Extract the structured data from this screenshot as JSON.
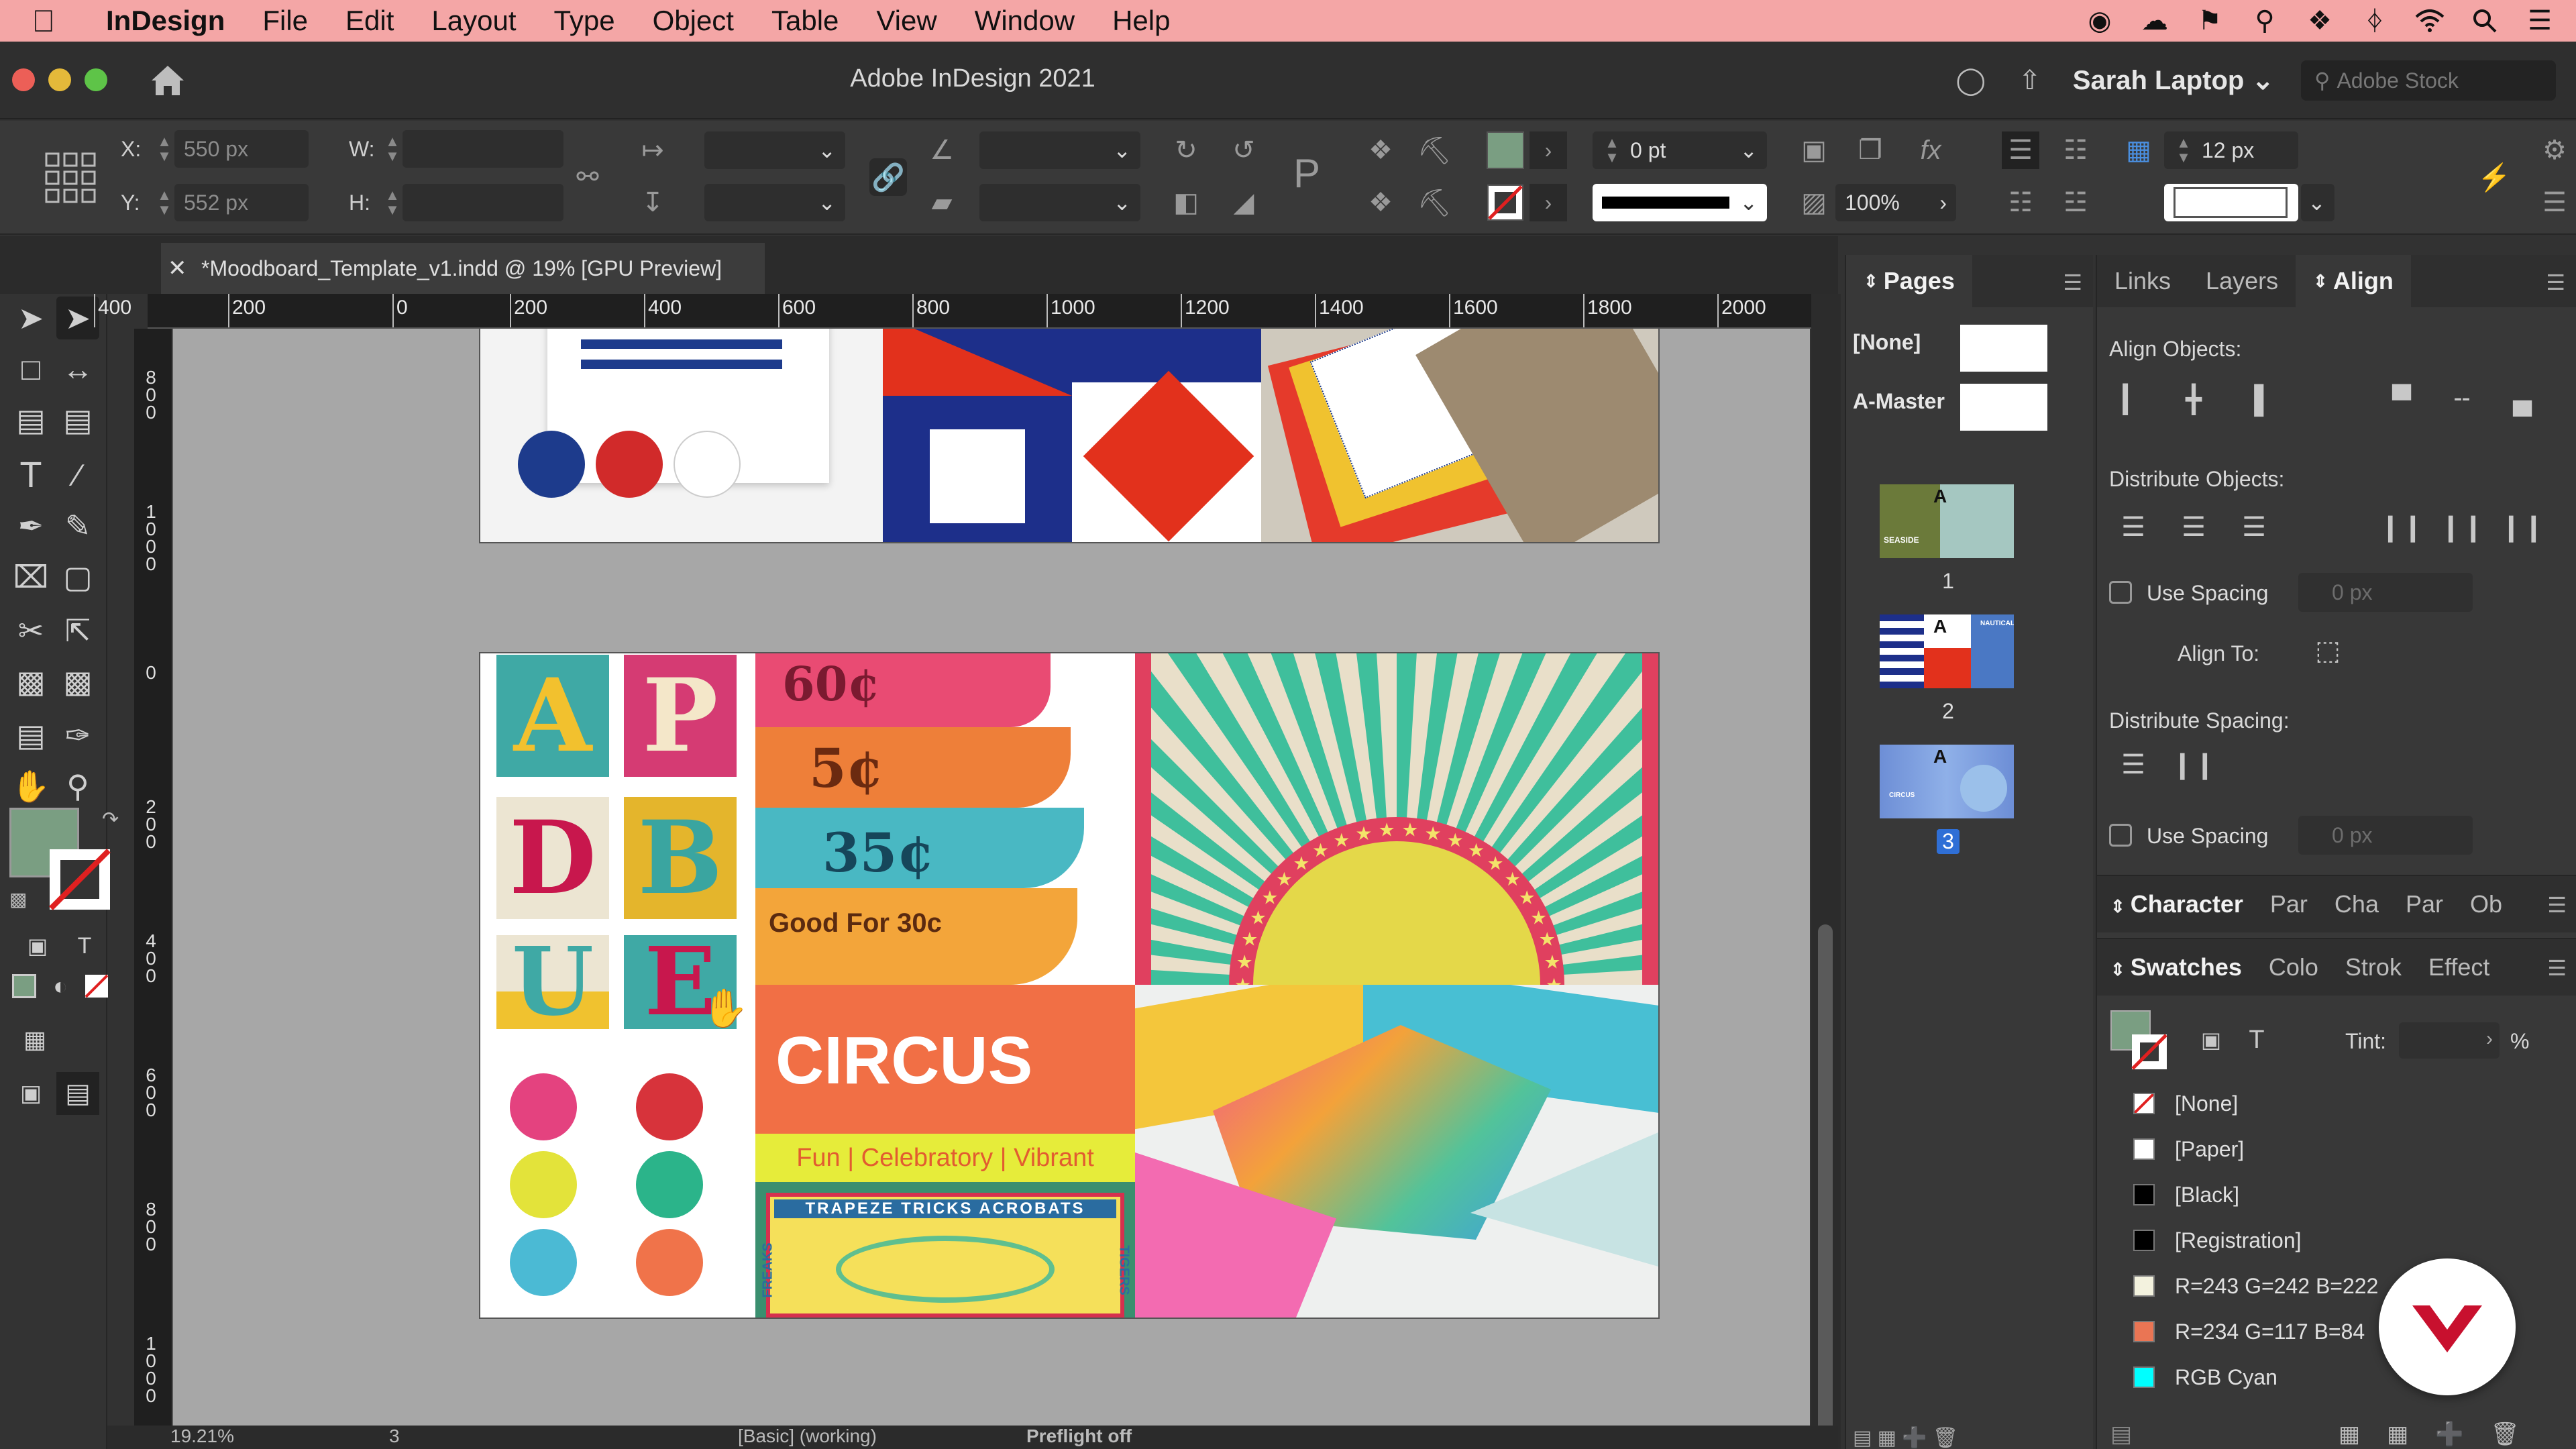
{
  "menubar": {
    "apple_icon": "apple-icon",
    "items": [
      "InDesign",
      "File",
      "Edit",
      "Layout",
      "Type",
      "Object",
      "Table",
      "View",
      "Window",
      "Help"
    ]
  },
  "titlebar": {
    "title": "Adobe InDesign 2021",
    "user": "Sarah Laptop",
    "stock_placeholder": "Adobe Stock"
  },
  "controlbar": {
    "x_label": "X:",
    "x_value": "550 px",
    "y_label": "Y:",
    "y_value": "552 px",
    "w_label": "W:",
    "w_value": "",
    "h_label": "H:",
    "h_value": "",
    "stroke_weight": "0 pt",
    "opacity": "100%",
    "spacing": "12 px",
    "fill_color": "#7a9e82"
  },
  "document_tab": {
    "title": "*Moodboard_Template_v1.indd @ 19% [GPU Preview]"
  },
  "ruler": {
    "h_ticks": [
      "400",
      "200",
      "0",
      "200",
      "400",
      "600",
      "800",
      "1000",
      "1200",
      "1400",
      "1600",
      "1800",
      "2000"
    ],
    "v_ticks": [
      "800",
      "1000",
      "0",
      "200",
      "400",
      "600",
      "800",
      "1000"
    ]
  },
  "canvas": {
    "circus_title": "CIRCUS",
    "circus_tagline": "Fun | Celebratory | Vibrant",
    "ticket_numbers": [
      "60¢",
      "5¢",
      "35¢"
    ],
    "ticket_text": "Good For 30c",
    "poster_text": "TRAPEZE TRICKS ACROBATS",
    "poster_side_left": "FREAKS",
    "poster_side_right": "TIGERS",
    "letters": [
      "A",
      "P",
      "D",
      "B",
      "U",
      "E"
    ],
    "palette": [
      "#e4427f",
      "#d7333b",
      "#e3e33a",
      "#2bb48a",
      "#4bbad4",
      "#f0734a"
    ]
  },
  "status": {
    "zoom": "19.21%",
    "page": "3",
    "profile": "[Basic] (working)",
    "preflight": "Preflight off"
  },
  "pages_panel": {
    "title": "Pages",
    "masters": [
      "[None]",
      "A-Master"
    ],
    "pages": [
      "1",
      "2",
      "3"
    ],
    "thumb_labels": [
      "SEASIDE",
      "NAUTICAL",
      "CIRCUS"
    ],
    "master_badge": "A"
  },
  "right_panel": {
    "tabs": [
      "Links",
      "Layers",
      "Align"
    ],
    "align_objects": "Align Objects:",
    "distribute_objects": "Distribute Objects:",
    "use_spacing": "Use Spacing",
    "spacing_value": "0 px",
    "align_to": "Align To:",
    "distribute_spacing": "Distribute Spacing:"
  },
  "character_panel": {
    "tabs": [
      "Character",
      "Par",
      "Cha",
      "Par",
      "Ob"
    ]
  },
  "swatches_panel": {
    "tabs": [
      "Swatches",
      "Colo",
      "Strok",
      "Effect"
    ],
    "tint_label": "Tint:",
    "tint_unit": "%",
    "text_icon_label": "T",
    "swatches": [
      {
        "name": "[None]",
        "color": "none"
      },
      {
        "name": "[Paper]",
        "color": "#ffffff"
      },
      {
        "name": "[Black]",
        "color": "#000000"
      },
      {
        "name": "[Registration]",
        "color": "#000000"
      },
      {
        "name": "R=243 G=242 B=222",
        "color": "#f3f2de"
      },
      {
        "name": "R=234 G=117 B=84",
        "color": "#ea7554"
      },
      {
        "name": "RGB Cyan",
        "color": "#00ffff"
      }
    ]
  }
}
